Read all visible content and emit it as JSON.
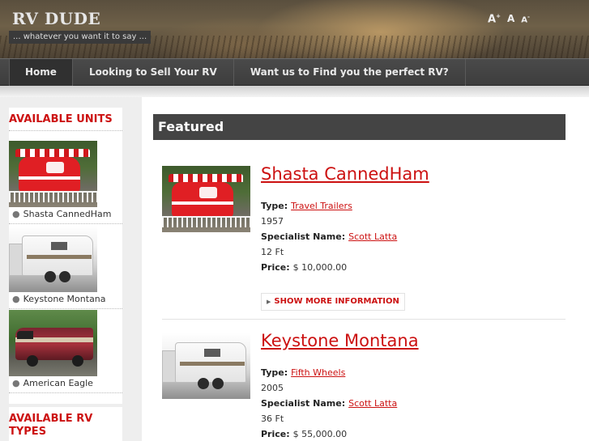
{
  "header": {
    "site_title": "RV DUDE",
    "tagline": "... whatever you want it to say ...",
    "font_tools": {
      "increase": "A",
      "reset": "A",
      "decrease": "A",
      "increase_mark": "+",
      "decrease_mark": "-"
    }
  },
  "nav": {
    "items": [
      {
        "label": "Home",
        "active": true
      },
      {
        "label": "Looking to Sell Your RV",
        "active": false
      },
      {
        "label": "Want us to Find you the perfect RV?",
        "active": false
      }
    ]
  },
  "sidebar": {
    "units_heading": "AVAILABLE UNITS",
    "units": [
      {
        "name": "Shasta CannedHam",
        "image": "red-vintage-trailer"
      },
      {
        "name": "Keystone Montana",
        "image": "white-fifth-wheel"
      },
      {
        "name": "American Eagle",
        "image": "red-motorhome"
      }
    ],
    "types_heading": "AVAILABLE RV TYPES"
  },
  "main": {
    "featured_heading": "Featured",
    "listings": [
      {
        "title": "Shasta CannedHam",
        "type_label": "Type:",
        "type_value": "Travel Trailers",
        "year": "1957",
        "specialist_label": "Specialist Name:",
        "specialist_value": "Scott Latta",
        "length": "12 Ft",
        "price_label": "Price:",
        "price_value": "$ 10,000.00",
        "more_label": "SHOW MORE INFORMATION"
      },
      {
        "title": "Keystone Montana",
        "type_label": "Type:",
        "type_value": "Fifth Wheels",
        "year": "2005",
        "specialist_label": "Specialist Name:",
        "specialist_value": "Scott Latta",
        "length": "36 Ft",
        "price_label": "Price:",
        "price_value": "$ 55,000.00"
      }
    ]
  },
  "colors": {
    "accent": "#cc1111",
    "header_bar": "#444444",
    "nav": "#3d3d3d"
  }
}
